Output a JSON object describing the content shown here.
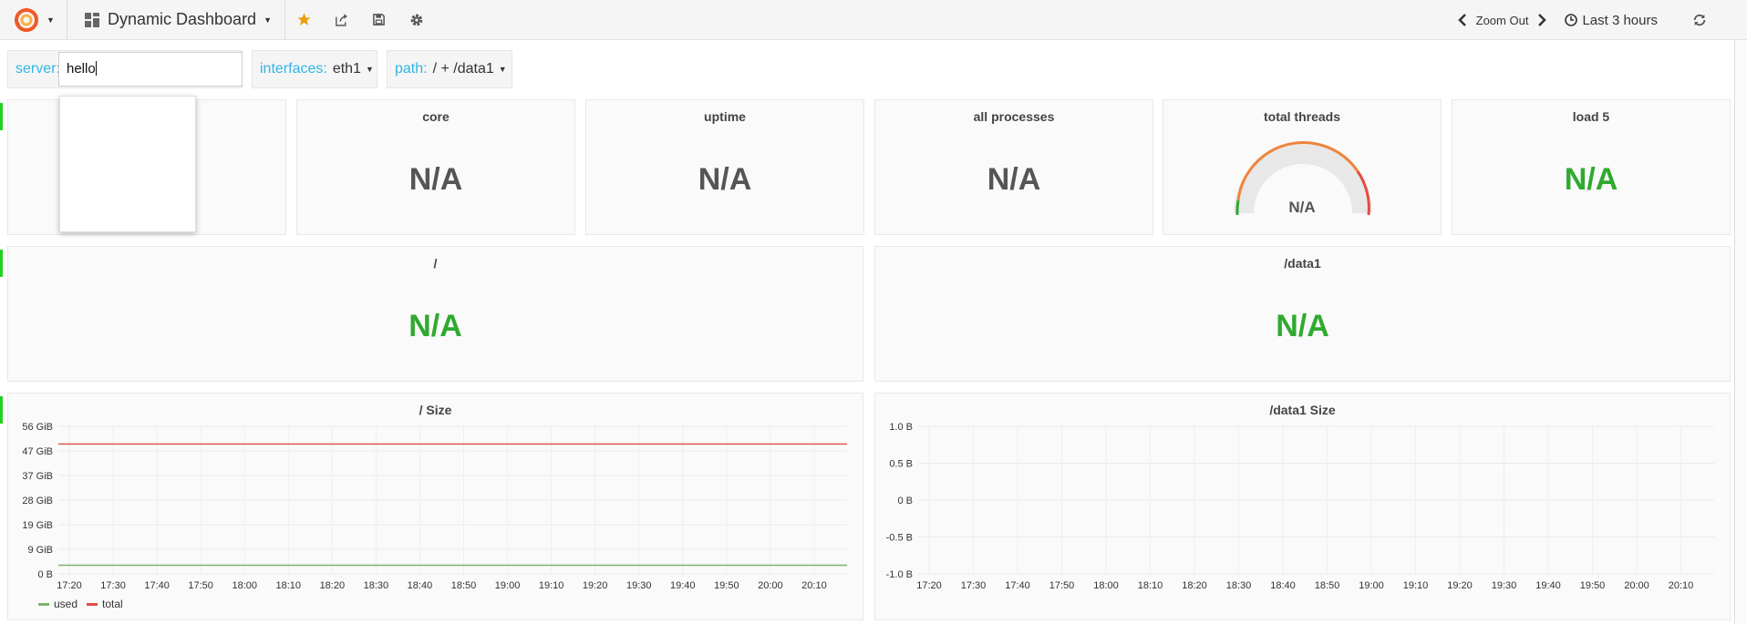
{
  "header": {
    "dashboard_title": "Dynamic Dashboard",
    "zoom_label": "Zoom Out",
    "time_range": "Last 3 hours"
  },
  "variables": {
    "server": {
      "label": "server:",
      "value": "hello"
    },
    "interfaces": {
      "label": "interfaces:",
      "value": "eth1"
    },
    "path": {
      "label": "path:",
      "value": "/ + /data1"
    }
  },
  "stats": {
    "core": {
      "title": "core",
      "value": "N/A"
    },
    "uptime": {
      "title": "uptime",
      "value": "N/A"
    },
    "all_processes": {
      "title": "all processes",
      "value": "N/A"
    },
    "total_threads": {
      "title": "total threads",
      "value": "N/A"
    },
    "load5": {
      "title": "load 5",
      "value": "N/A"
    },
    "root": {
      "title": "/",
      "value": "N/A"
    },
    "data1": {
      "title": "/data1",
      "value": "N/A"
    }
  },
  "colors": {
    "accent": "#33b5e5",
    "green": "#2faa2f",
    "row_marker": "#1fd21f",
    "used_series": "#7eb26d",
    "total_series": "#e24d42",
    "star": "#eb9e0f"
  },
  "icons": [
    "grafana-logo-icon",
    "dashboard-grid-icon",
    "star-icon",
    "share-icon",
    "save-icon",
    "gear-icon",
    "chevron-left-icon",
    "chevron-right-icon",
    "clock-icon",
    "refresh-icon"
  ],
  "chart_data": [
    {
      "type": "line",
      "title": "/ Size",
      "x": [
        "17:20",
        "17:30",
        "17:40",
        "17:50",
        "18:00",
        "18:10",
        "18:20",
        "18:30",
        "18:40",
        "18:50",
        "19:00",
        "19:10",
        "19:20",
        "19:30",
        "19:40",
        "19:50",
        "20:00",
        "20:10"
      ],
      "y_ticks": [
        "56 GiB",
        "47 GiB",
        "37 GiB",
        "28 GiB",
        "19 GiB",
        "9 GiB",
        "0 B"
      ],
      "ylim": [
        0,
        56
      ],
      "grid": true,
      "legend_position": "bottom-left",
      "series": [
        {
          "name": "used",
          "values": [
            3.3,
            3.3,
            3.3,
            3.3,
            3.3,
            3.3,
            3.3,
            3.3,
            3.3,
            3.3,
            3.3,
            3.3,
            3.3,
            3.3,
            3.3,
            3.3,
            3.3,
            3.3
          ]
        },
        {
          "name": "total",
          "values": [
            49.3,
            49.3,
            49.3,
            49.3,
            49.3,
            49.3,
            49.3,
            49.3,
            49.3,
            49.3,
            49.3,
            49.3,
            49.3,
            49.3,
            49.3,
            49.3,
            49.3,
            49.3
          ]
        }
      ]
    },
    {
      "type": "line",
      "title": "/data1 Size",
      "x": [
        "17:20",
        "17:30",
        "17:40",
        "17:50",
        "18:00",
        "18:10",
        "18:20",
        "18:30",
        "18:40",
        "18:50",
        "19:00",
        "19:10",
        "19:20",
        "19:30",
        "19:40",
        "19:50",
        "20:00",
        "20:10"
      ],
      "y_ticks": [
        "1.0 B",
        "0.5 B",
        "0 B",
        "-0.5 B",
        "-1.0 B"
      ],
      "ylim": [
        -1,
        1
      ],
      "grid": true,
      "series": []
    }
  ]
}
